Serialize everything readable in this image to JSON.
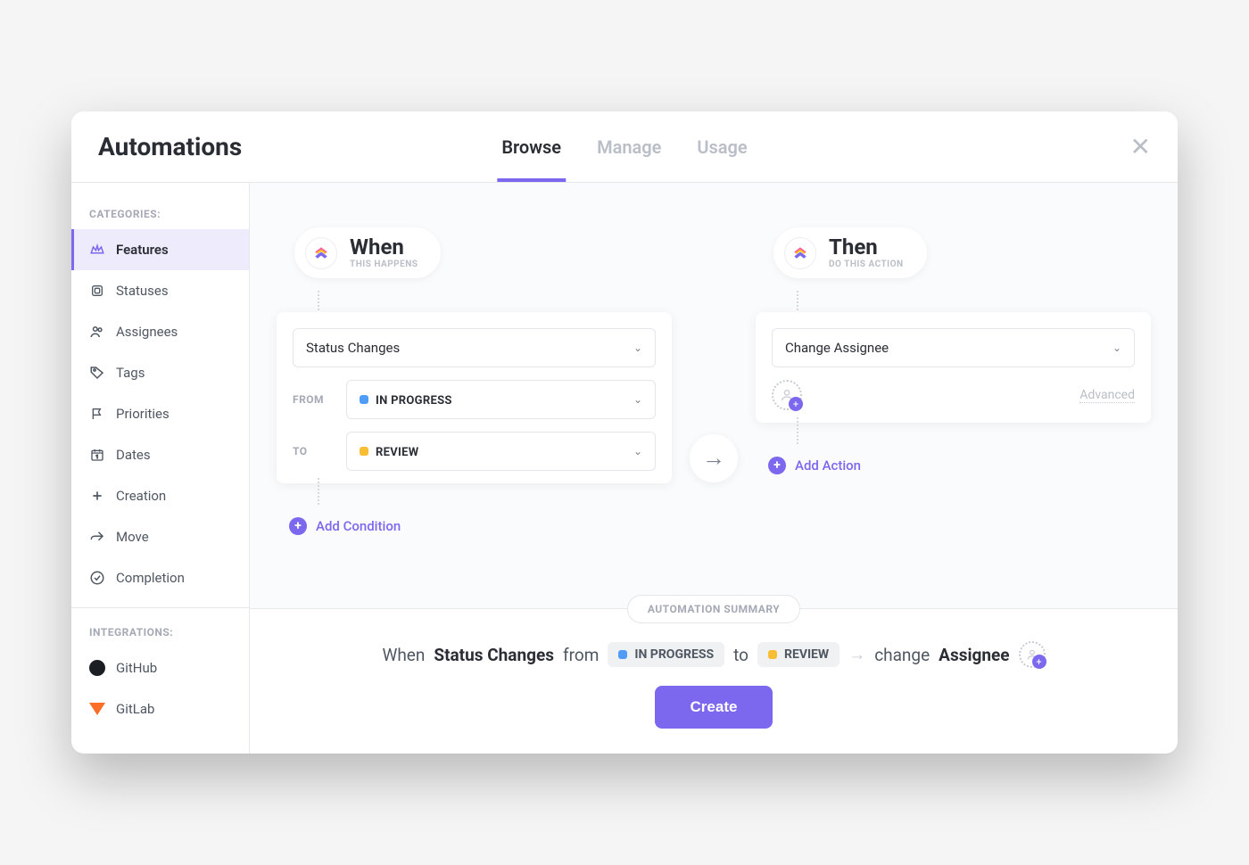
{
  "header": {
    "title": "Automations",
    "tabs": [
      {
        "label": "Browse",
        "active": true
      },
      {
        "label": "Manage",
        "active": false
      },
      {
        "label": "Usage",
        "active": false
      }
    ]
  },
  "sidebar": {
    "categories_label": "CATEGORIES:",
    "integrations_label": "INTEGRATIONS:",
    "items": [
      {
        "label": "Features",
        "icon": "crown"
      },
      {
        "label": "Statuses",
        "icon": "square"
      },
      {
        "label": "Assignees",
        "icon": "users"
      },
      {
        "label": "Tags",
        "icon": "tag"
      },
      {
        "label": "Priorities",
        "icon": "flag"
      },
      {
        "label": "Dates",
        "icon": "calendar"
      },
      {
        "label": "Creation",
        "icon": "plus"
      },
      {
        "label": "Move",
        "icon": "forward"
      },
      {
        "label": "Completion",
        "icon": "check-circle"
      }
    ],
    "integrations": [
      {
        "label": "GitHub"
      },
      {
        "label": "GitLab"
      }
    ]
  },
  "builder": {
    "when": {
      "title": "When",
      "subtitle": "THIS HAPPENS",
      "trigger": "Status Changes",
      "from_label": "FROM",
      "to_label": "TO",
      "from_status": "IN PROGRESS",
      "to_status": "REVIEW",
      "add_condition": "Add Condition"
    },
    "then": {
      "title": "Then",
      "subtitle": "DO THIS ACTION",
      "action": "Change Assignee",
      "advanced": "Advanced",
      "add_action": "Add Action"
    }
  },
  "summary": {
    "badge": "AUTOMATION SUMMARY",
    "when_text": "When",
    "trigger": "Status Changes",
    "from_text": "from",
    "from_status": "IN PROGRESS",
    "to_text": "to",
    "to_status": "REVIEW",
    "change_text": "change",
    "action_target": "Assignee",
    "create_button": "Create"
  },
  "colors": {
    "accent": "#7b68ee",
    "in_progress": "#4f9cf9",
    "review": "#f9be34"
  }
}
